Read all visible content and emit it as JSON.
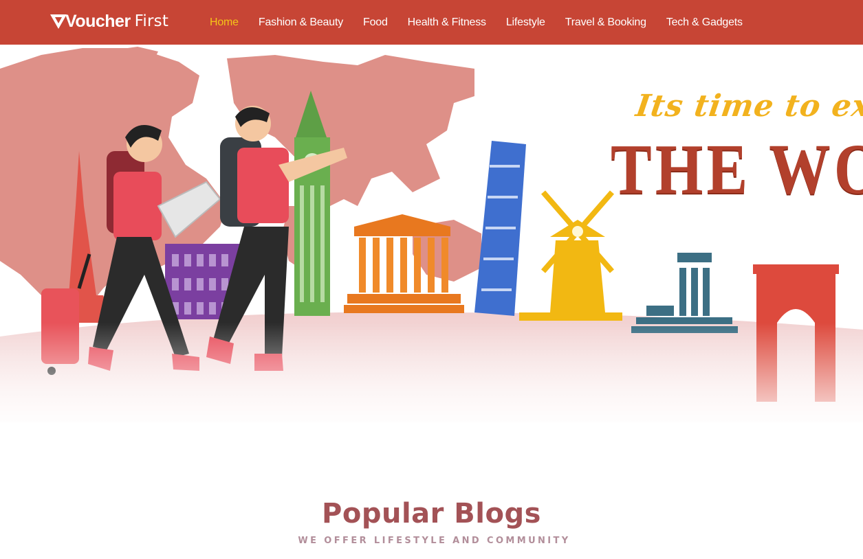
{
  "header": {
    "logo": {
      "bold": "Voucher",
      "light": "First",
      "icon": "voucher-v-logo"
    },
    "nav": [
      {
        "label": "Home",
        "active": true
      },
      {
        "label": "Fashion & Beauty",
        "active": false
      },
      {
        "label": "Food",
        "active": false
      },
      {
        "label": "Health & Fitness",
        "active": false
      },
      {
        "label": "Lifestyle",
        "active": false
      },
      {
        "label": "Travel & Booking",
        "active": false
      },
      {
        "label": "Tech & Gadgets",
        "active": false
      }
    ]
  },
  "hero": {
    "tagline": "Its time to exp",
    "headline": "THE WOR",
    "illustration": "travelers-with-world-landmarks"
  },
  "section": {
    "title": "Popular Blogs",
    "subtitle": "WE OFFER LIFESTYLE AND COMMUNITY"
  },
  "colors": {
    "header_bg": "#c74535",
    "nav_active": "#f5c518",
    "title": "#a35256",
    "subtitle": "#b28e9a",
    "map": "#de9088"
  }
}
